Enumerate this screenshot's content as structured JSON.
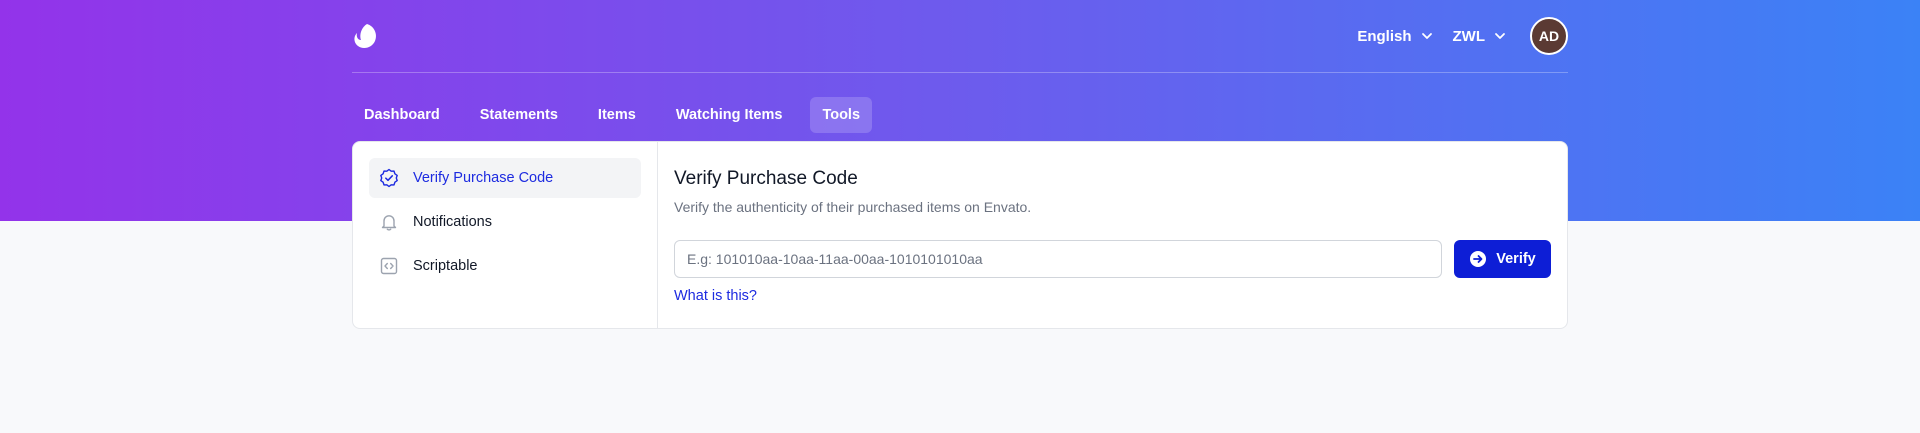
{
  "header": {
    "logo_icon": "envato-leaf-icon",
    "language": "English",
    "currency": "ZWL",
    "avatar_initials": "AD"
  },
  "nav": {
    "items": [
      {
        "label": "Dashboard",
        "active": false
      },
      {
        "label": "Statements",
        "active": false
      },
      {
        "label": "Items",
        "active": false
      },
      {
        "label": "Watching Items",
        "active": false
      },
      {
        "label": "Tools",
        "active": true
      }
    ]
  },
  "sidebar": {
    "items": [
      {
        "label": "Verify Purchase Code",
        "icon": "badge-check-icon",
        "active": true
      },
      {
        "label": "Notifications",
        "icon": "bell-icon",
        "active": false
      },
      {
        "label": "Scriptable",
        "icon": "code-icon",
        "active": false
      }
    ]
  },
  "main": {
    "title": "Verify Purchase Code",
    "subtitle": "Verify the authenticity of their purchased items on Envato.",
    "input": {
      "placeholder": "E.g: 101010aa-10aa-11aa-00aa-1010101010aa",
      "value": ""
    },
    "verify_button": "Verify",
    "help_link": "What is this?"
  },
  "colors": {
    "gradient_start": "#9333ea",
    "gradient_end": "#3b82f6",
    "accent": "#0d1ed6",
    "avatar_bg": "#5b3a33"
  }
}
